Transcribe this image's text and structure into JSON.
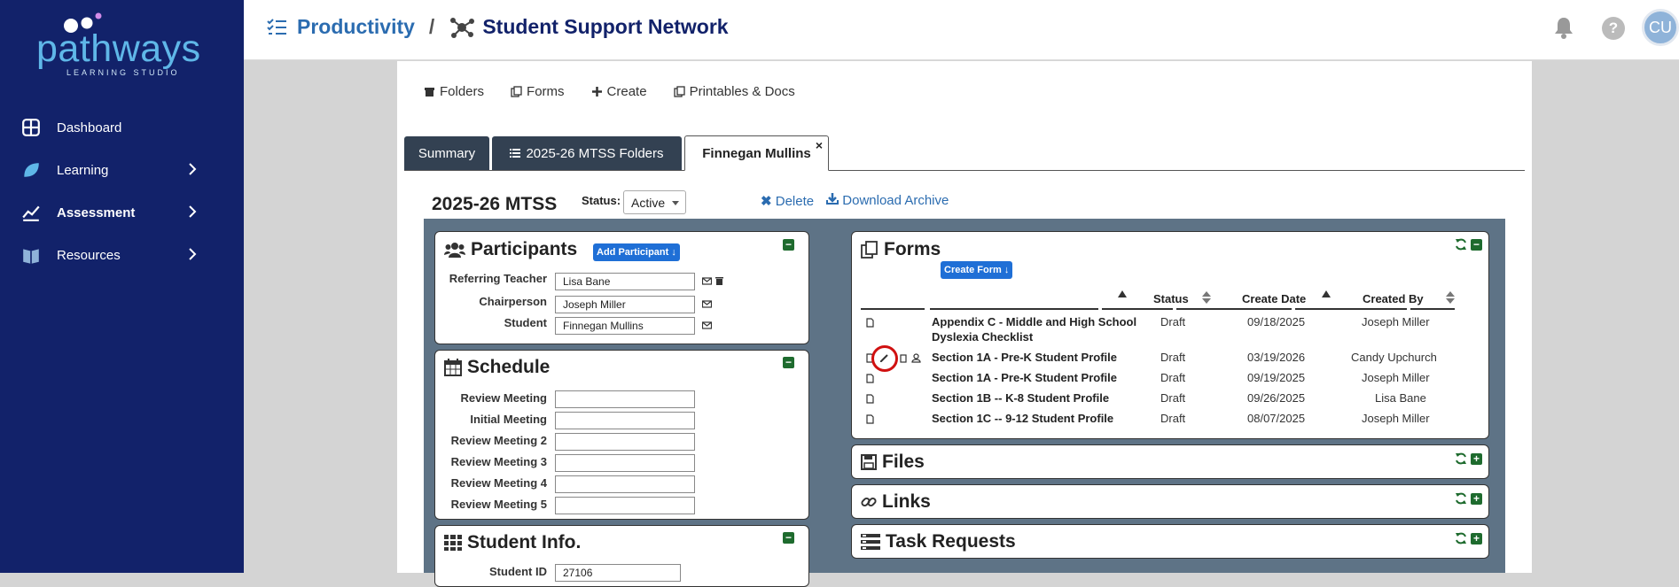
{
  "app": {
    "brand": "pathways",
    "brand_sub": "LEARNING STUDIO"
  },
  "sidebar": {
    "items": [
      {
        "label": "Dashboard",
        "icon": "dashboard-icon"
      },
      {
        "label": "Learning",
        "icon": "leaf-icon"
      },
      {
        "label": "Assessment",
        "icon": "chart-icon"
      },
      {
        "label": "Resources",
        "icon": "book-icon"
      }
    ]
  },
  "header": {
    "crumb1": "Productivity",
    "separator": "/",
    "crumb2": "Student Support Network",
    "avatar": "CU"
  },
  "toolbar": {
    "folders": "Folders",
    "forms": "Forms",
    "create": "Create",
    "printables": "Printables & Docs"
  },
  "tabs": [
    {
      "label": "Summary"
    },
    {
      "label": "2025-26 MTSS Folders"
    },
    {
      "label": "Finnegan Mullins"
    }
  ],
  "record": {
    "title": "2025-26 MTSS",
    "status_label": "Status:",
    "status_value": "Active",
    "delete": "Delete",
    "download": "Download Archive"
  },
  "participants": {
    "title": "Participants",
    "add_button": "Add Participant ↓",
    "rows": [
      {
        "label": "Referring Teacher",
        "value": "Lisa Bane"
      },
      {
        "label": "Chairperson",
        "value": "Joseph Miller"
      },
      {
        "label": "Student",
        "value": "Finnegan Mullins"
      }
    ]
  },
  "schedule": {
    "title": "Schedule",
    "rows": [
      {
        "label": "Review Meeting",
        "value": ""
      },
      {
        "label": "Initial Meeting",
        "value": ""
      },
      {
        "label": "Review Meeting 2",
        "value": ""
      },
      {
        "label": "Review Meeting 3",
        "value": ""
      },
      {
        "label": "Review Meeting 4",
        "value": ""
      },
      {
        "label": "Review Meeting 5",
        "value": ""
      }
    ]
  },
  "student_info": {
    "title": "Student Info.",
    "student_id_label": "Student ID",
    "student_id_value": "27106"
  },
  "forms": {
    "title": "Forms",
    "create_button": "Create Form ↓",
    "columns": [
      "Status",
      "Create Date",
      "Created By"
    ],
    "rows": [
      {
        "name1": "Appendix C - Middle and High School",
        "name2": "Dyslexia Checklist",
        "status": "Draft",
        "date": "09/18/2025",
        "by": "Joseph Miller"
      },
      {
        "name1": "Section 1A - Pre-K Student Profile",
        "name2": "",
        "status": "Draft",
        "date": "03/19/2026",
        "by": "Candy Upchurch"
      },
      {
        "name1": "Section 1A - Pre-K Student Profile",
        "name2": "",
        "status": "Draft",
        "date": "09/19/2025",
        "by": "Joseph Miller"
      },
      {
        "name1": "Section 1B -- K-8 Student Profile",
        "name2": "",
        "status": "Draft",
        "date": "09/26/2025",
        "by": "Lisa Bane"
      },
      {
        "name1": "Section 1C -- 9-12 Student Profile",
        "name2": "",
        "status": "Draft",
        "date": "08/07/2025",
        "by": "Joseph Miller"
      }
    ]
  },
  "files": {
    "title": "Files"
  },
  "links": {
    "title": "Links"
  },
  "tasks": {
    "title": "Task Requests"
  }
}
